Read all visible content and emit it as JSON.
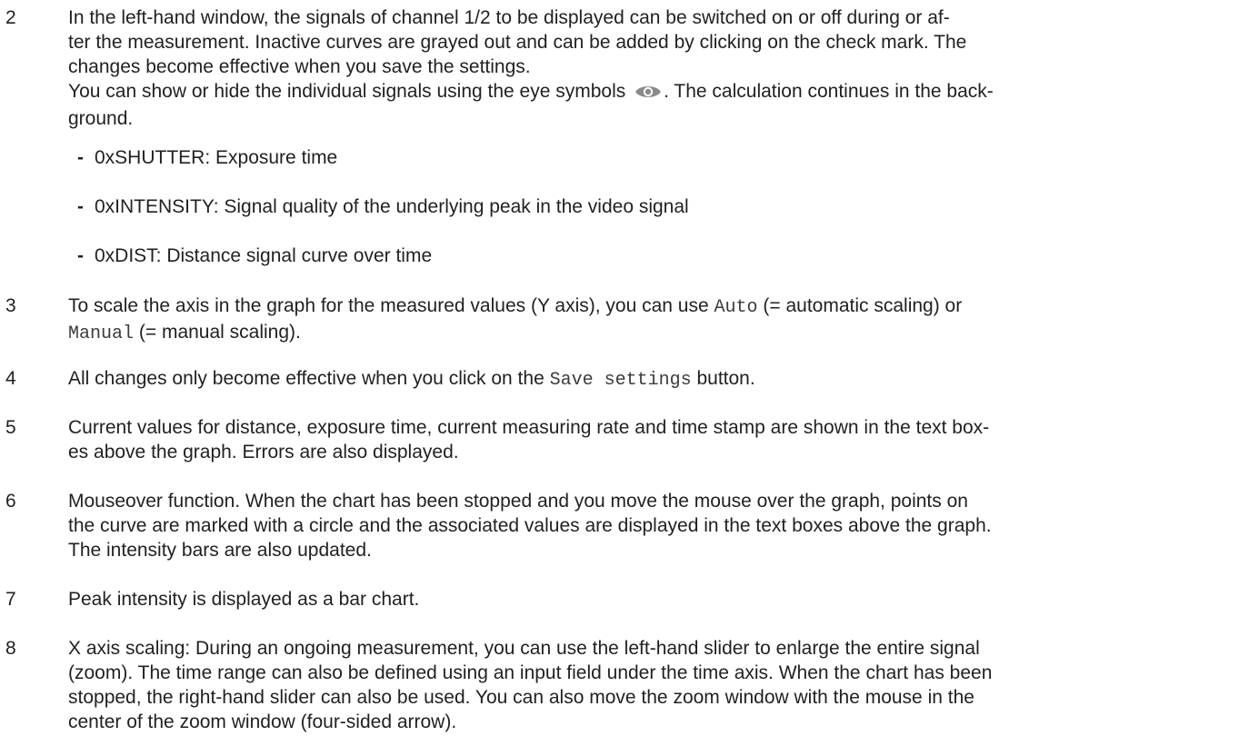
{
  "items": [
    {
      "num": "2",
      "lines": [
        "In the left-hand window, the signals of channel 1/2 to be displayed can be switched on or off during or af-",
        "ter the measurement. Inactive curves are grayed out and can be added by clicking on the check mark. The",
        "changes become effective when you save the settings."
      ],
      "eye_line": {
        "before": "You can show or hide the individual signals using the eye symbols",
        "after": ". The calculation continues in the back-",
        "cont": "ground."
      },
      "bullets": [
        "0xSHUTTER: Exposure time",
        "0xINTENSITY: Signal quality of the underlying peak in the video signal",
        "0xDIST: Distance signal curve over time"
      ]
    },
    {
      "num": "3",
      "l1_a": "To scale the axis in the graph for the measured values (Y axis), you can use",
      "l1_code": "Auto",
      "l1_b": "(= automatic scaling) or",
      "l2_code": "Manual",
      "l2_b": "(= manual scaling)."
    },
    {
      "num": "4",
      "a": "All changes only become effective when you click on the",
      "code": "Save settings",
      "b": "button."
    },
    {
      "num": "5",
      "lines": [
        "Current values for distance, exposure time, current measuring rate and time stamp are shown in the text box-",
        "es above the graph. Errors are also displayed."
      ]
    },
    {
      "num": "6",
      "lines": [
        "Mouseover function. When the chart has been stopped and you move the mouse over the graph, points on",
        "the curve are marked with a circle and the associated values are displayed in the text boxes above the graph.",
        "The intensity bars are also updated."
      ]
    },
    {
      "num": "7",
      "lines": [
        "Peak intensity is displayed as a bar chart."
      ]
    },
    {
      "num": "8",
      "lines": [
        "X axis scaling: During an ongoing measurement, you can use the left-hand slider to enlarge the entire signal",
        "(zoom). The time range can also be defined using an input field under the time axis. When the chart has been",
        "stopped, the right-hand slider can also be used. You can also move the zoom window with the mouse in the",
        "center of the zoom window (four-sided arrow)."
      ]
    }
  ],
  "bullet_marker": "-",
  "icons": {
    "eye": "eye-icon"
  }
}
